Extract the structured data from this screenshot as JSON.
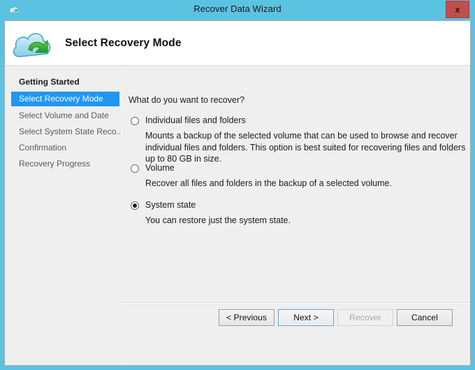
{
  "window": {
    "title": "Recover Data Wizard",
    "close_label": "x",
    "app_icon": "cloud-icon"
  },
  "banner": {
    "title": "Select Recovery Mode",
    "icon": "cloud-restore-icon"
  },
  "sidebar": {
    "items": [
      {
        "label": "Getting Started",
        "state": "completed"
      },
      {
        "label": "Select Recovery Mode",
        "state": "active"
      },
      {
        "label": "Select Volume and Date",
        "state": "pending"
      },
      {
        "label": "Select System State Reco...",
        "state": "pending"
      },
      {
        "label": "Confirmation",
        "state": "pending"
      },
      {
        "label": "Recovery Progress",
        "state": "pending"
      }
    ]
  },
  "content": {
    "question": "What do you want to recover?",
    "options": [
      {
        "label": "Individual files and folders",
        "description": "Mounts a backup of the selected volume that can be used to browse and recover individual files and folders. This option is best suited for recovering files and folders up to 80 GB in size.",
        "selected": false
      },
      {
        "label": "Volume",
        "description": "Recover all files and folders in the backup of a selected volume.",
        "selected": false
      },
      {
        "label": "System state",
        "description": "You can restore just the system state.",
        "selected": true
      }
    ]
  },
  "footer": {
    "buttons": [
      {
        "label": "< Previous",
        "state": "enabled"
      },
      {
        "label": "Next >",
        "state": "focused"
      },
      {
        "label": "Recover",
        "state": "disabled"
      },
      {
        "label": "Cancel",
        "state": "enabled"
      }
    ]
  },
  "colors": {
    "frame": "#5bc2e2",
    "accent": "#2196f3",
    "close": "#c0504d",
    "panel": "#efefef"
  }
}
